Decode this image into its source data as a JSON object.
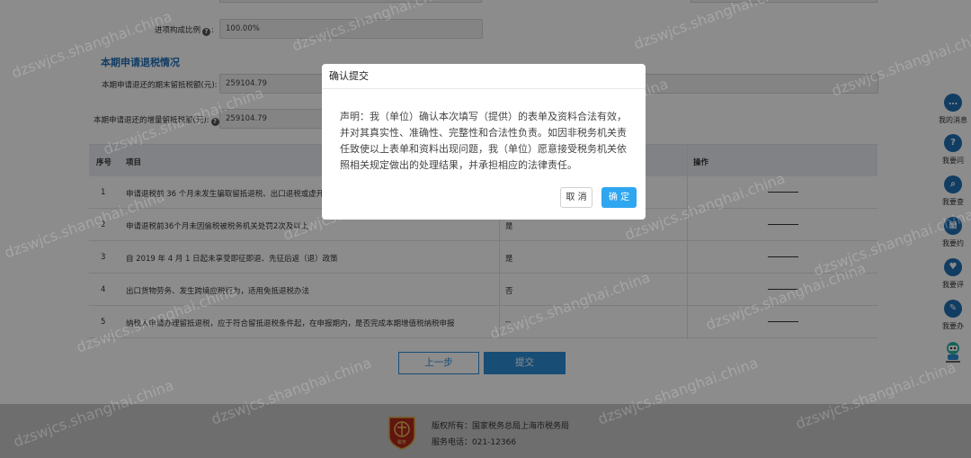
{
  "form": {
    "ratio_label": "进项构成比例",
    "ratio_value": "100.00%",
    "section_title": "本期申请退税情况",
    "end_credit_label": "本期申请退还的期末留抵税额(元):",
    "end_credit_value": "259104.79",
    "incr_credit_label": "本期申请退还的增量留抵税额(元):",
    "incr_credit_value": "259104.79"
  },
  "table": {
    "headers": {
      "no": "序号",
      "item": "项目",
      "op": "操作"
    },
    "rows": [
      {
        "no": "1",
        "item": "申请退税前 36 个月未发生骗取留抵退税、出口退税或虚开",
        "value": "",
        "op": "———"
      },
      {
        "no": "2",
        "item": "申请退税前36个月未因偷税被税务机关处罚2次及以上",
        "value": "是",
        "op": "———"
      },
      {
        "no": "3",
        "item": "自 2019 年 4 月 1 日起未享受即征即退、先征后返（退）政策",
        "value": "是",
        "op": "———"
      },
      {
        "no": "4",
        "item": "出口货物劳务、发生跨境应税行为，适用免抵退税办法",
        "value": "否",
        "op": "———"
      },
      {
        "no": "5",
        "item": "纳税人申请办理留抵退税，应于符合留抵退税条件起，在申报期内，是否完成本期增值税纳税申报",
        "value": "--",
        "op": "———"
      }
    ]
  },
  "actions": {
    "prev": "上一步",
    "submit": "提交"
  },
  "footer": {
    "copyright": "版权所有：国家税务总局上海市税务局",
    "phone": "服务电话：021-12366",
    "logo_text": "税务"
  },
  "sidebar": [
    {
      "label": "我的消息",
      "icon": "message-icon",
      "glyph": "…"
    },
    {
      "label": "我要问",
      "icon": "question-icon",
      "glyph": "?"
    },
    {
      "label": "我要查",
      "icon": "search-icon",
      "glyph": "⌕"
    },
    {
      "label": "我要约",
      "icon": "calendar-icon",
      "glyph": "▦"
    },
    {
      "label": "我要评",
      "icon": "rate-icon",
      "glyph": "♥"
    },
    {
      "label": "我要办",
      "icon": "edit-icon",
      "glyph": "✎"
    }
  ],
  "modal": {
    "title": "确认提交",
    "body": "声明：我（单位）确认本次填写（提供）的表单及资料合法有效，并对其真实性、准确性、完整性和合法性负责。如因非税务机关责任致使以上表单和资料出现问题，我（单位）愿意接受税务机关依照相关规定做出的处理结果，并承担相应的法律责任。",
    "cancel": "取 消",
    "ok": "确 定"
  },
  "watermark": "dzswjcs.shanghai.china",
  "colors": {
    "primary": "#2d8cd8",
    "section_title": "#1f6fb5",
    "ok_button": "#2ea6f0"
  }
}
